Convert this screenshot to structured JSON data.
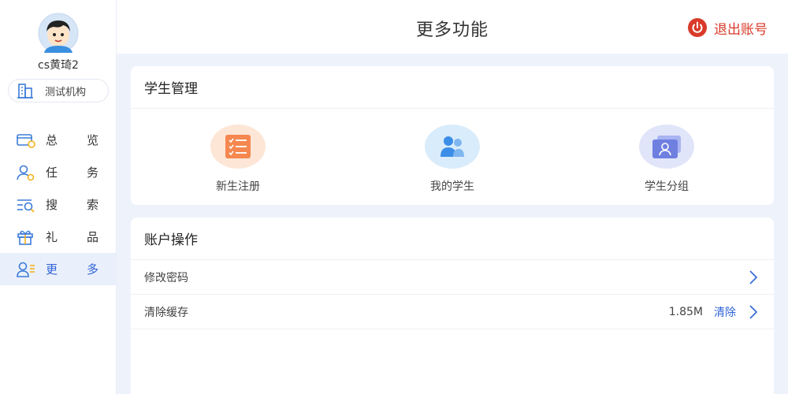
{
  "sidebar": {
    "username": "cs黄琦2",
    "org": "测试机构",
    "items": [
      {
        "c1": "总",
        "c2": "览",
        "icon": "overview-card-icon",
        "active": false
      },
      {
        "c1": "任",
        "c2": "务",
        "icon": "task-user-icon",
        "active": false
      },
      {
        "c1": "搜",
        "c2": "索",
        "icon": "search-list-icon",
        "active": false
      },
      {
        "c1": "礼",
        "c2": "品",
        "icon": "gift-icon",
        "active": false
      },
      {
        "c1": "更",
        "c2": "多",
        "icon": "more-user-icon",
        "active": true
      }
    ]
  },
  "header": {
    "title": "更多功能",
    "logout": "退出账号"
  },
  "student_card": {
    "title": "学生管理",
    "features": [
      {
        "label": "新生注册",
        "icon": "register-list-icon"
      },
      {
        "label": "我的学生",
        "icon": "students-group-icon"
      },
      {
        "label": "学生分组",
        "icon": "student-card-icon"
      }
    ]
  },
  "account_card": {
    "title": "账户操作",
    "change_password": "修改密码",
    "clear_cache": "清除缓存",
    "cache_size": "1.85M",
    "clear_action": "清除"
  },
  "colors": {
    "accent": "#2f63d8",
    "logout_red": "#d93a2a",
    "orange": "#f5874f",
    "blue": "#3b8ee8",
    "indigo": "#6f7fe0"
  }
}
